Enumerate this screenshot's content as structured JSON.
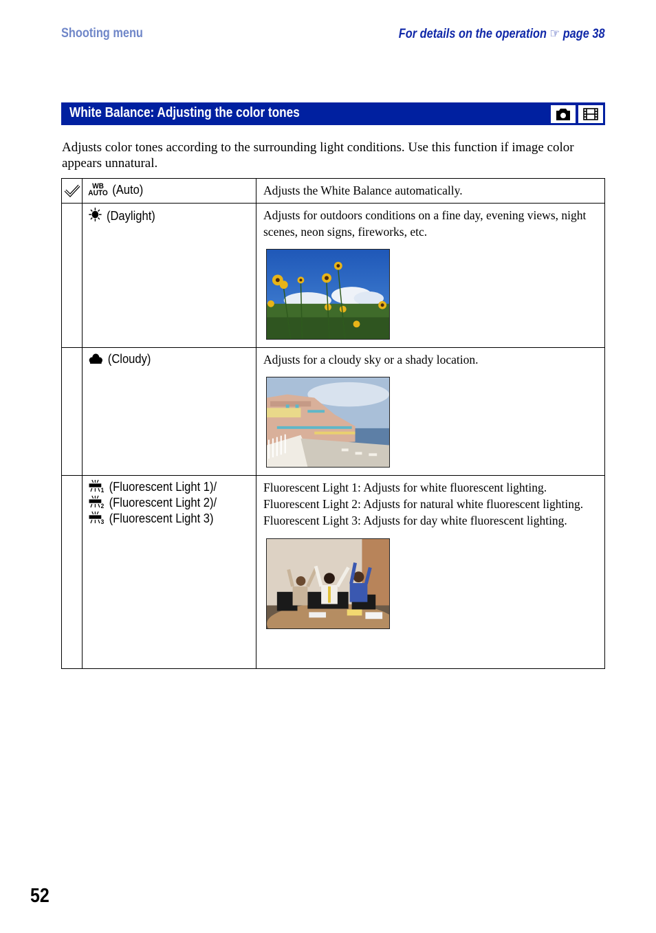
{
  "header": {
    "section": "Shooting menu",
    "crossref_text": "For details on the operation",
    "crossref_icon": "pointing-hand-icon",
    "crossref_page": "page 38"
  },
  "banner": {
    "title": "White Balance: Adjusting the color tones",
    "mode_icons": [
      "camera-still-mode-icon",
      "movie-mode-icon"
    ],
    "color": "#0020a0"
  },
  "intro": "Adjusts color tones according to the surrounding light conditions. Use this function if image color appears unnatural.",
  "table": {
    "rows": [
      {
        "default": true,
        "icon": "wb-auto-icon",
        "icon_text": {
          "top": "WB",
          "bottom": "AUTO"
        },
        "labels": [
          "(Auto)"
        ],
        "description": [
          "Adjusts the White Balance automatically."
        ],
        "photo": null
      },
      {
        "default": false,
        "icon": "daylight-sun-icon",
        "labels": [
          "(Daylight)"
        ],
        "description": [
          "Adjusts for outdoors conditions on a fine day, evening views, night scenes, neon signs, fireworks, etc."
        ],
        "photo": "sunflowers-photo"
      },
      {
        "default": false,
        "icon": "cloudy-icon",
        "labels": [
          "(Cloudy)"
        ],
        "description": [
          "Adjusts for a cloudy sky or a shady location."
        ],
        "photo": "seaside-hotel-photo"
      },
      {
        "default": false,
        "icon": "fluorescent-icon",
        "labels": [
          "(Fluorescent Light 1)/",
          "(Fluorescent Light 2)/",
          "(Fluorescent Light 3)"
        ],
        "icon_subscripts": [
          "1",
          "2",
          "3"
        ],
        "description": [
          "Fluorescent Light 1: Adjusts for white fluorescent lighting.",
          "Fluorescent Light 2: Adjusts for natural white fluorescent lighting.",
          "Fluorescent Light 3: Adjusts for day white fluorescent lighting."
        ],
        "photo": "office-celebration-photo"
      }
    ]
  },
  "page_number": "52"
}
